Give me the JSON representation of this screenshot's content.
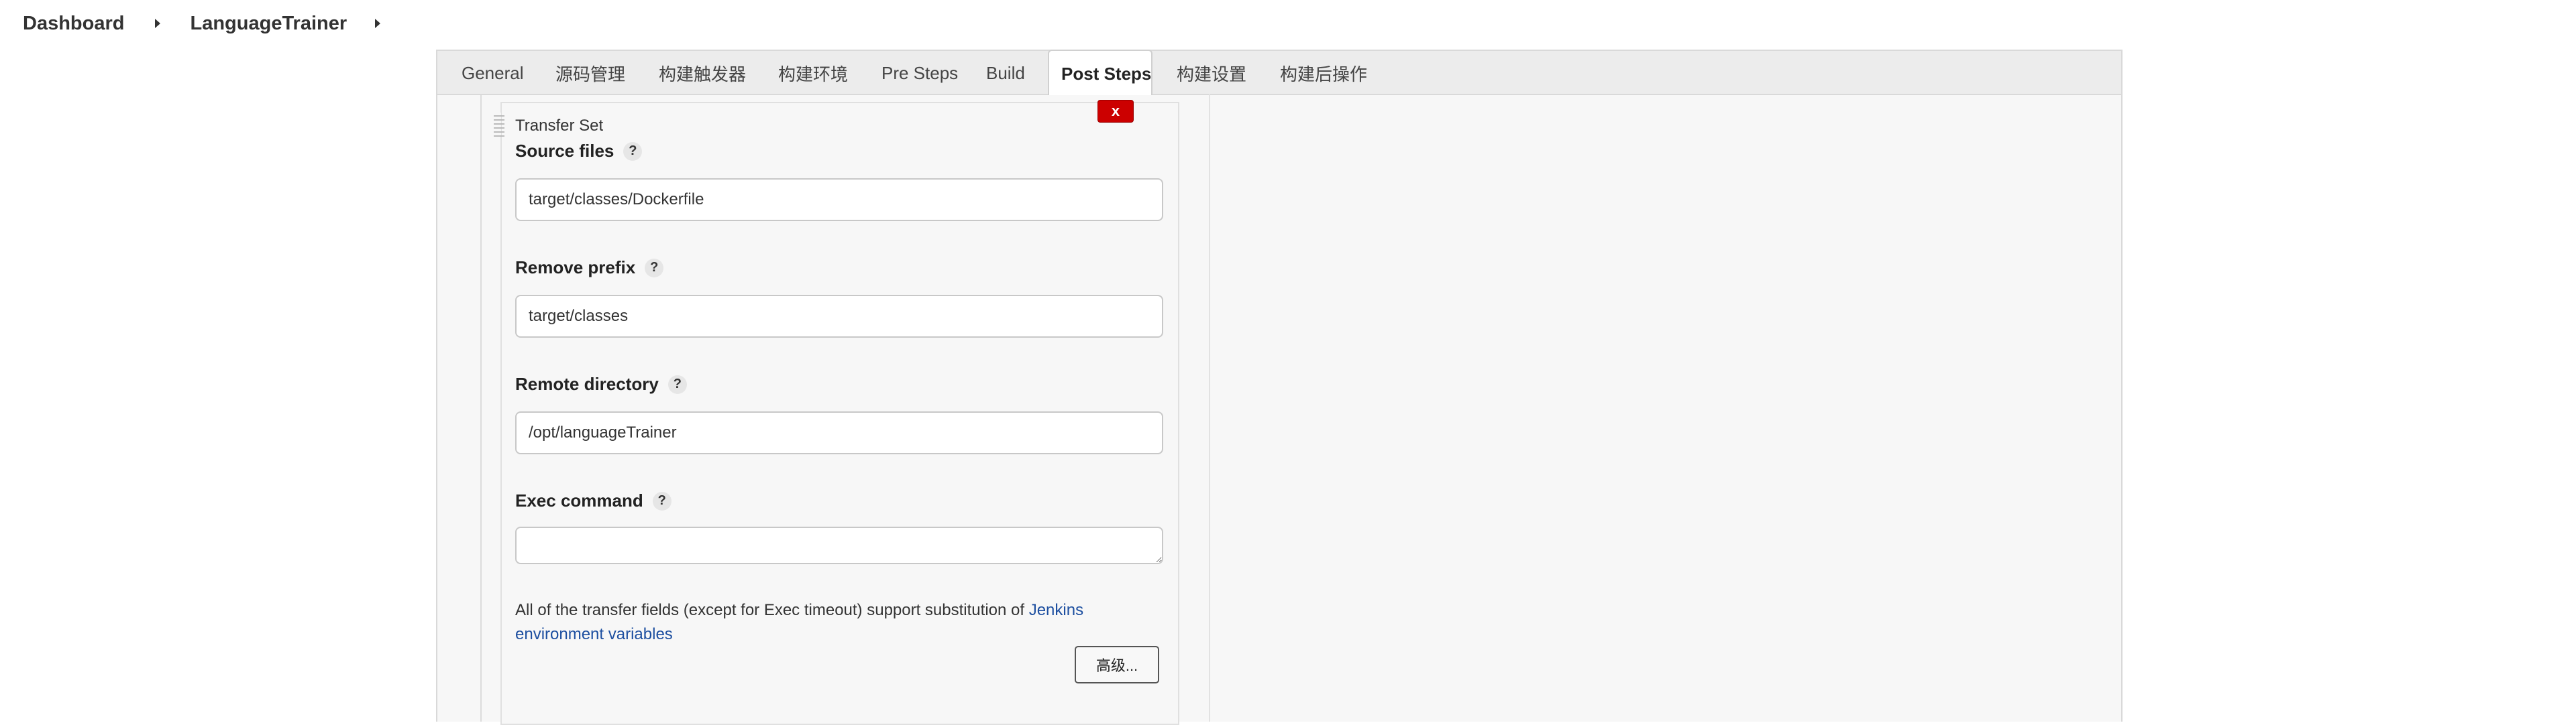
{
  "breadcrumb": {
    "items": [
      "Dashboard",
      "LanguageTrainer"
    ]
  },
  "tabs": [
    {
      "label": "General",
      "active": false
    },
    {
      "label": "源码管理",
      "active": false
    },
    {
      "label": "构建触发器",
      "active": false
    },
    {
      "label": "构建环境",
      "active": false
    },
    {
      "label": "Pre Steps",
      "active": false
    },
    {
      "label": "Build",
      "active": false
    },
    {
      "label": "Post Steps",
      "active": true
    },
    {
      "label": "构建设置",
      "active": false
    },
    {
      "label": "构建后操作",
      "active": false
    }
  ],
  "transfer_set": {
    "title": "Transfer Set",
    "delete_label": "x",
    "source_files": {
      "label": "Source files",
      "value": "target/classes/Dockerfile"
    },
    "remove_prefix": {
      "label": "Remove prefix",
      "value": "target/classes"
    },
    "remote_directory": {
      "label": "Remote directory",
      "value": "/opt/languageTrainer"
    },
    "exec_command": {
      "label": "Exec command",
      "value": ""
    },
    "help_icon": "?",
    "help_text_prefix": "All of the transfer fields (except for Exec timeout) support substitution of ",
    "help_link_1": "Jenkins",
    "help_link_2": "environment variables",
    "advanced_label": "高级..."
  },
  "colors": {
    "accent_link": "#1d4fa0",
    "delete_button": "#cc0000",
    "panel_background": "#f7f7f7"
  }
}
